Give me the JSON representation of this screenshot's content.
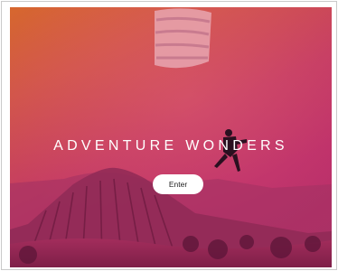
{
  "hero": {
    "title": "ADVENTURE WONDERS",
    "enter_label": "Enter"
  },
  "colors": {
    "accent_orange": "#d6672e",
    "accent_magenta": "#bd2f6a",
    "button_bg": "#ffffff"
  }
}
